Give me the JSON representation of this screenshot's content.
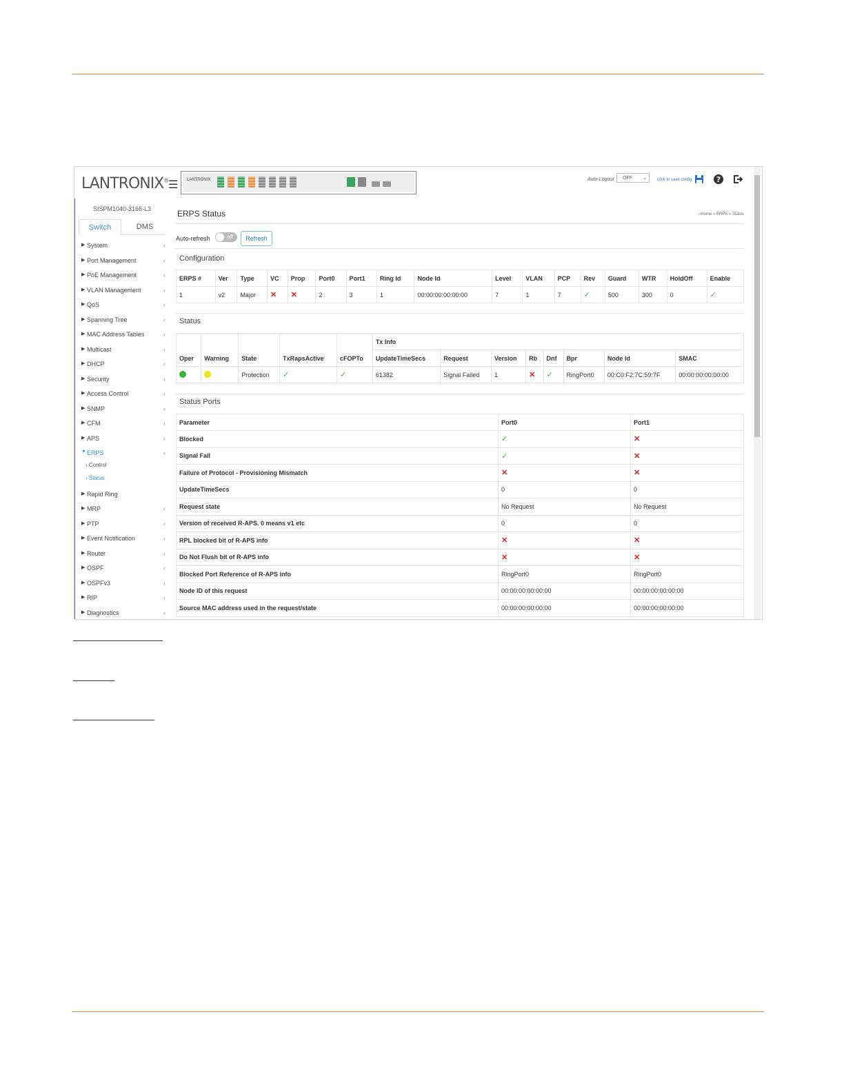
{
  "header": {
    "logo": "LANTRONIX",
    "logo_mark": "®",
    "panel_logo": "LANTRONIX",
    "auto_logout_label": "Auto-Logout",
    "auto_logout_value": "OFF",
    "click_save_label": "click to save config"
  },
  "sidebar": {
    "model": "SISPM1040-3166-L3",
    "tabs": [
      "Switch",
      "DMS"
    ],
    "items": [
      "System",
      "Port Management",
      "PoE Management",
      "VLAN Management",
      "QoS",
      "Spanning Tree",
      "MAC Address Tables",
      "Multicast",
      "DHCP",
      "Security",
      "Access Control",
      "SNMP",
      "CFM",
      "APS",
      "ERPS"
    ],
    "erps_sub": [
      "Control",
      "Status"
    ],
    "items2": [
      "Rapid Ring",
      "MRP",
      "PTP",
      "Event Notification",
      "Router",
      "OSPF",
      "OSPFv3",
      "RIP",
      "Diagnostics"
    ]
  },
  "main": {
    "title": "ERPS Status",
    "breadcrumb": "Home » ERPS » Status",
    "auto_refresh_label": "Auto-refresh",
    "toggle_label": "off",
    "refresh_button": "Refresh",
    "config_title": "Configuration",
    "config_headers": [
      "ERPS #",
      "Ver",
      "Type",
      "VC",
      "Prop",
      "Port0",
      "Port1",
      "Ring Id",
      "Node Id",
      "Level",
      "VLAN",
      "PCP",
      "Rev",
      "Guard",
      "WTR",
      "HoldOff",
      "Enable"
    ],
    "config_row": [
      "1",
      "v2",
      "Major",
      "x",
      "x",
      "2",
      "3",
      "1",
      "00:00:00:00:00:00",
      "7",
      "1",
      "7",
      "check",
      "500",
      "300",
      "0",
      "check"
    ],
    "status_title": "Status",
    "tx_info_label": "Tx Info",
    "status_headers": [
      "Oper",
      "Warning",
      "State",
      "TxRapsActive",
      "cFOPTo",
      "UpdateTimeSecs",
      "Request",
      "Version",
      "Rb",
      "Dnf",
      "Bpr",
      "Node Id",
      "SMAC"
    ],
    "status_row": [
      "green-dot",
      "yellow-dot",
      "Protection",
      "check",
      "check",
      "61382",
      "Signal Failed",
      "1",
      "x",
      "check",
      "RingPort0",
      "00:C0:F2:7C:59:7F",
      "00:00:00:00:00:00"
    ],
    "ports_title": "Status Ports",
    "ports_headers": [
      "Parameter",
      "Port0",
      "Port1"
    ],
    "ports_rows": [
      [
        "Blocked",
        "check",
        "x"
      ],
      [
        "Signal Fail",
        "check",
        "x"
      ],
      [
        "Failure of Protocol - Provisioning Mismatch",
        "x",
        "x"
      ],
      [
        "UpdateTimeSecs",
        "0",
        "0"
      ],
      [
        "Request state",
        "No Request",
        "No Request"
      ],
      [
        "Version of received R-APS. 0 means v1 etc",
        "0",
        "0"
      ],
      [
        "RPL blocked bit of R-APS info",
        "x",
        "x"
      ],
      [
        "Do Not Flush bit of R-APS info",
        "x",
        "x"
      ],
      [
        "Blocked Port Reference of R-APS info",
        "RingPort0",
        "RingPort0"
      ],
      [
        "Node ID of this request",
        "00:00:00:00:00:00",
        "00:00:00:00:00:00"
      ],
      [
        "Source MAC address used in the request/state",
        "00:00:00:00:00:00",
        "00:00:00:00:00:00"
      ]
    ]
  },
  "colors": {
    "accent_rule": "#d9894a",
    "link": "#3a6fc5",
    "cross": "#e02020",
    "check": "#3bb33b"
  }
}
